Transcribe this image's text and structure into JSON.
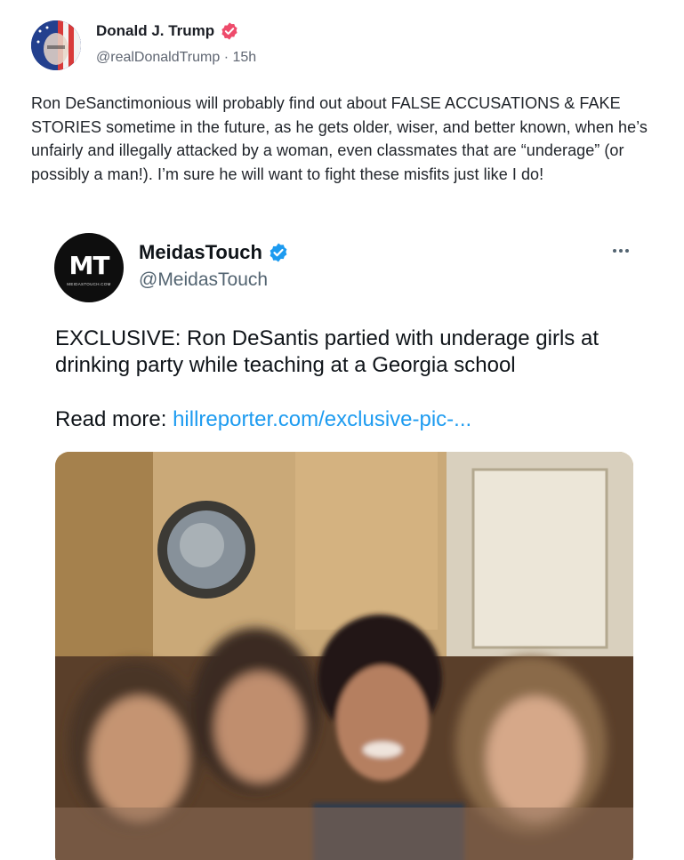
{
  "post": {
    "author_name": "Donald J. Trump",
    "handle": "@realDonaldTrump",
    "separator": "·",
    "time_ago": "15h",
    "body": "Ron DeSanctimonious will probably find out about FALSE ACCUSATIONS & FAKE STORIES sometime in the future, as he gets older, wiser, and better known, when he’s unfairly and illegally attacked by a woman, even classmates that are “underage” (or possibly a man!). I’m sure he will want to fight these misfits just like I do!",
    "verified_color": "#ee4b6b"
  },
  "embed": {
    "logo_letters": "MT",
    "logo_subtext": "MEIDASTOUCH.COM",
    "author_name": "MeidasTouch",
    "handle": "@MeidasTouch",
    "text": "EXCLUSIVE: Ron DeSantis partied with underage girls at drinking party while teaching at a Georgia school",
    "link_prefix": "Read more: ",
    "link_text": "hillreporter.com/exclusive-pic-...",
    "verified_color": "#1d9bf0",
    "link_color": "#1d9bf0"
  }
}
